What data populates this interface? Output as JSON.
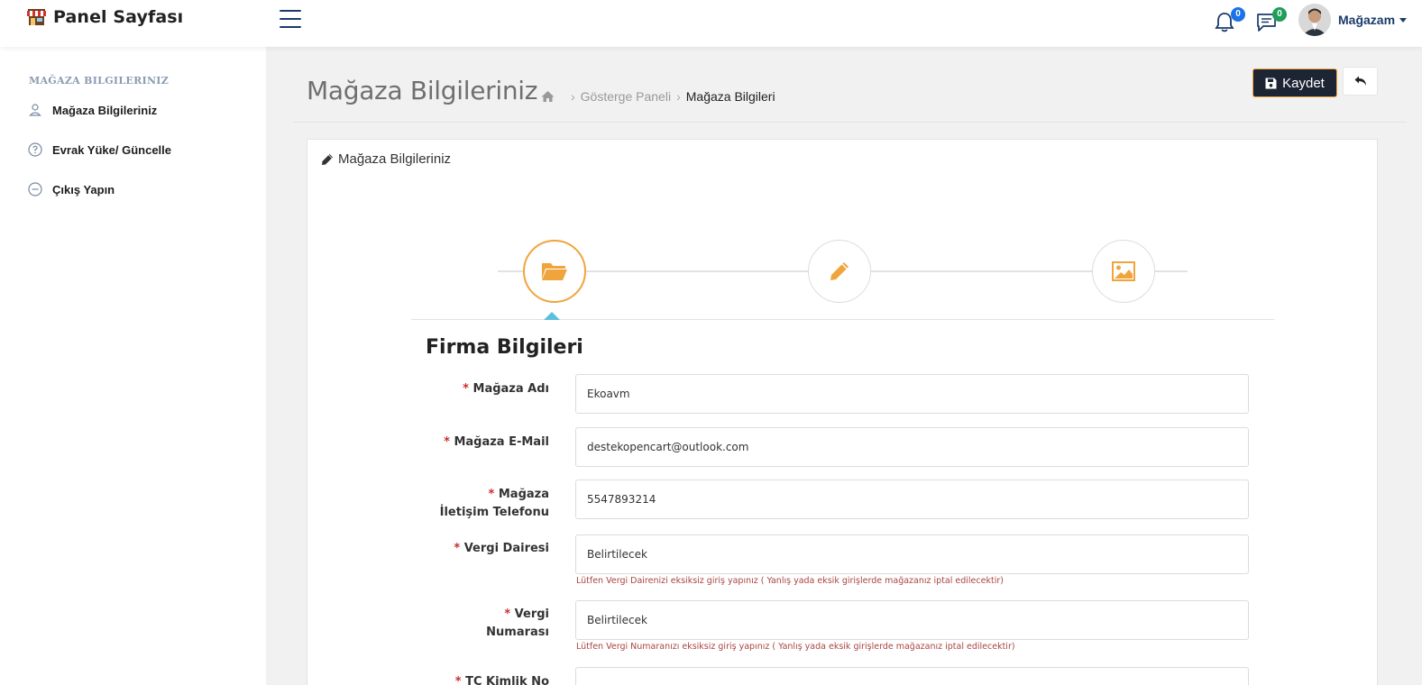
{
  "topbar": {
    "brand_title": "Panel Sayfası",
    "notifications_count": "0",
    "messages_count": "0",
    "user_name": "Mağazam"
  },
  "sidebar": {
    "heading": "MAĞAZA BILGILERINIZ",
    "items": [
      {
        "label": "Mağaza Bilgileriniz",
        "icon": "user-icon"
      },
      {
        "label": "Evrak Yüke/ Güncelle",
        "icon": "question-circle-icon"
      },
      {
        "label": "Çıkış Yapın",
        "icon": "minus-circle-icon"
      }
    ]
  },
  "header": {
    "page_title": "Mağaza Bilgileriniz",
    "breadcrumb": [
      "Gösterge Paneli",
      "Mağaza Bilgileri"
    ],
    "save_label": "Kaydet"
  },
  "card": {
    "title": "Mağaza Bilgileriniz",
    "wizard_steps": [
      "folder-open-icon",
      "pencil-icon",
      "image-icon"
    ],
    "section_title": "Firma Bilgileri"
  },
  "form": {
    "store_name": {
      "label": "Mağaza Adı",
      "value": "Ekoavm"
    },
    "store_email": {
      "label": "Mağaza E-Mail",
      "value": "destekopencart@outlook.com"
    },
    "store_phone": {
      "label_line1": "Mağaza",
      "label_line2": "İletişim Telefonu",
      "value": "5547893214"
    },
    "tax_office": {
      "label": "Vergi Dairesi",
      "value": "Belirtilecek",
      "help": "Lütfen Vergi Dairenizi eksiksiz giriş yapınız ( Yanlış yada eksik girişlerde mağazanız iptal edilecektir)"
    },
    "tax_number": {
      "label_line1": "Vergi",
      "label_line2": "Numarası",
      "value": "Belirtilecek",
      "help": "Lütfen Vergi Numaranızı eksiksiz giriş yapınız ( Yanlış yada eksik girişlerde mağazanız iptal edilecektir)"
    },
    "tc_id": {
      "label": "TC Kimlik No",
      "value": ""
    }
  },
  "colors": {
    "accent": "#f0a43c",
    "navy": "#1a3a6b",
    "save_button_bg": "#1d2535",
    "required": "#c9302c",
    "help_text": "#a94442",
    "badge_blue": "#1a73e8",
    "badge_green": "#1e9e5a"
  }
}
